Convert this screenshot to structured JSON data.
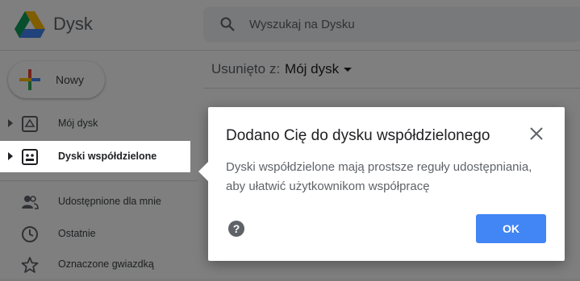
{
  "app": {
    "title": "Dysk"
  },
  "search": {
    "placeholder": "Wyszukaj na Dysku"
  },
  "sidebar": {
    "new_label": "Nowy",
    "items": [
      {
        "label": "Mój dysk",
        "icon": "my-drive-icon"
      },
      {
        "label": "Dyski współdzielone",
        "icon": "shared-drives-icon"
      },
      {
        "label": "Udostępnione dla mnie",
        "icon": "shared-with-me-icon"
      },
      {
        "label": "Ostatnie",
        "icon": "clock-icon"
      },
      {
        "label": "Oznaczone gwiazdką",
        "icon": "star-icon"
      }
    ]
  },
  "content": {
    "removed_from_label": "Usunięto z:",
    "drive_name": "Mój dysk"
  },
  "dialog": {
    "title": "Dodano Cię do dysku współdzielonego",
    "body": "Dyski współdzielone mają prostsze reguły udostępniania, aby ułatwić użytkownikom współpracę",
    "ok_label": "OK"
  },
  "colors": {
    "primary": "#4285f4",
    "overlay": "rgba(0,0,0,0.5)"
  }
}
